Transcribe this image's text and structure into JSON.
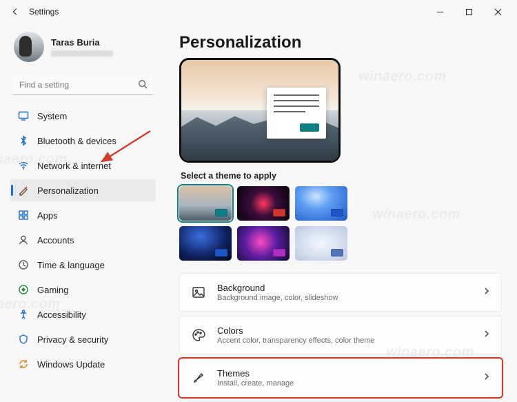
{
  "window": {
    "title": "Settings"
  },
  "user": {
    "name": "Taras Buria"
  },
  "search": {
    "placeholder": "Find a setting"
  },
  "sidebar": {
    "items": [
      {
        "label": "System"
      },
      {
        "label": "Bluetooth & devices"
      },
      {
        "label": "Network & internet"
      },
      {
        "label": "Personalization"
      },
      {
        "label": "Apps"
      },
      {
        "label": "Accounts"
      },
      {
        "label": "Time & language"
      },
      {
        "label": "Gaming"
      },
      {
        "label": "Accessibility"
      },
      {
        "label": "Privacy & security"
      },
      {
        "label": "Windows Update"
      }
    ]
  },
  "main": {
    "heading": "Personalization",
    "theme_prompt": "Select a theme to apply",
    "cards": [
      {
        "title": "Background",
        "subtitle": "Background image, color, slideshow"
      },
      {
        "title": "Colors",
        "subtitle": "Accent color, transparency effects, color theme"
      },
      {
        "title": "Themes",
        "subtitle": "Install, create, manage"
      }
    ]
  },
  "watermark": "winaero.com"
}
